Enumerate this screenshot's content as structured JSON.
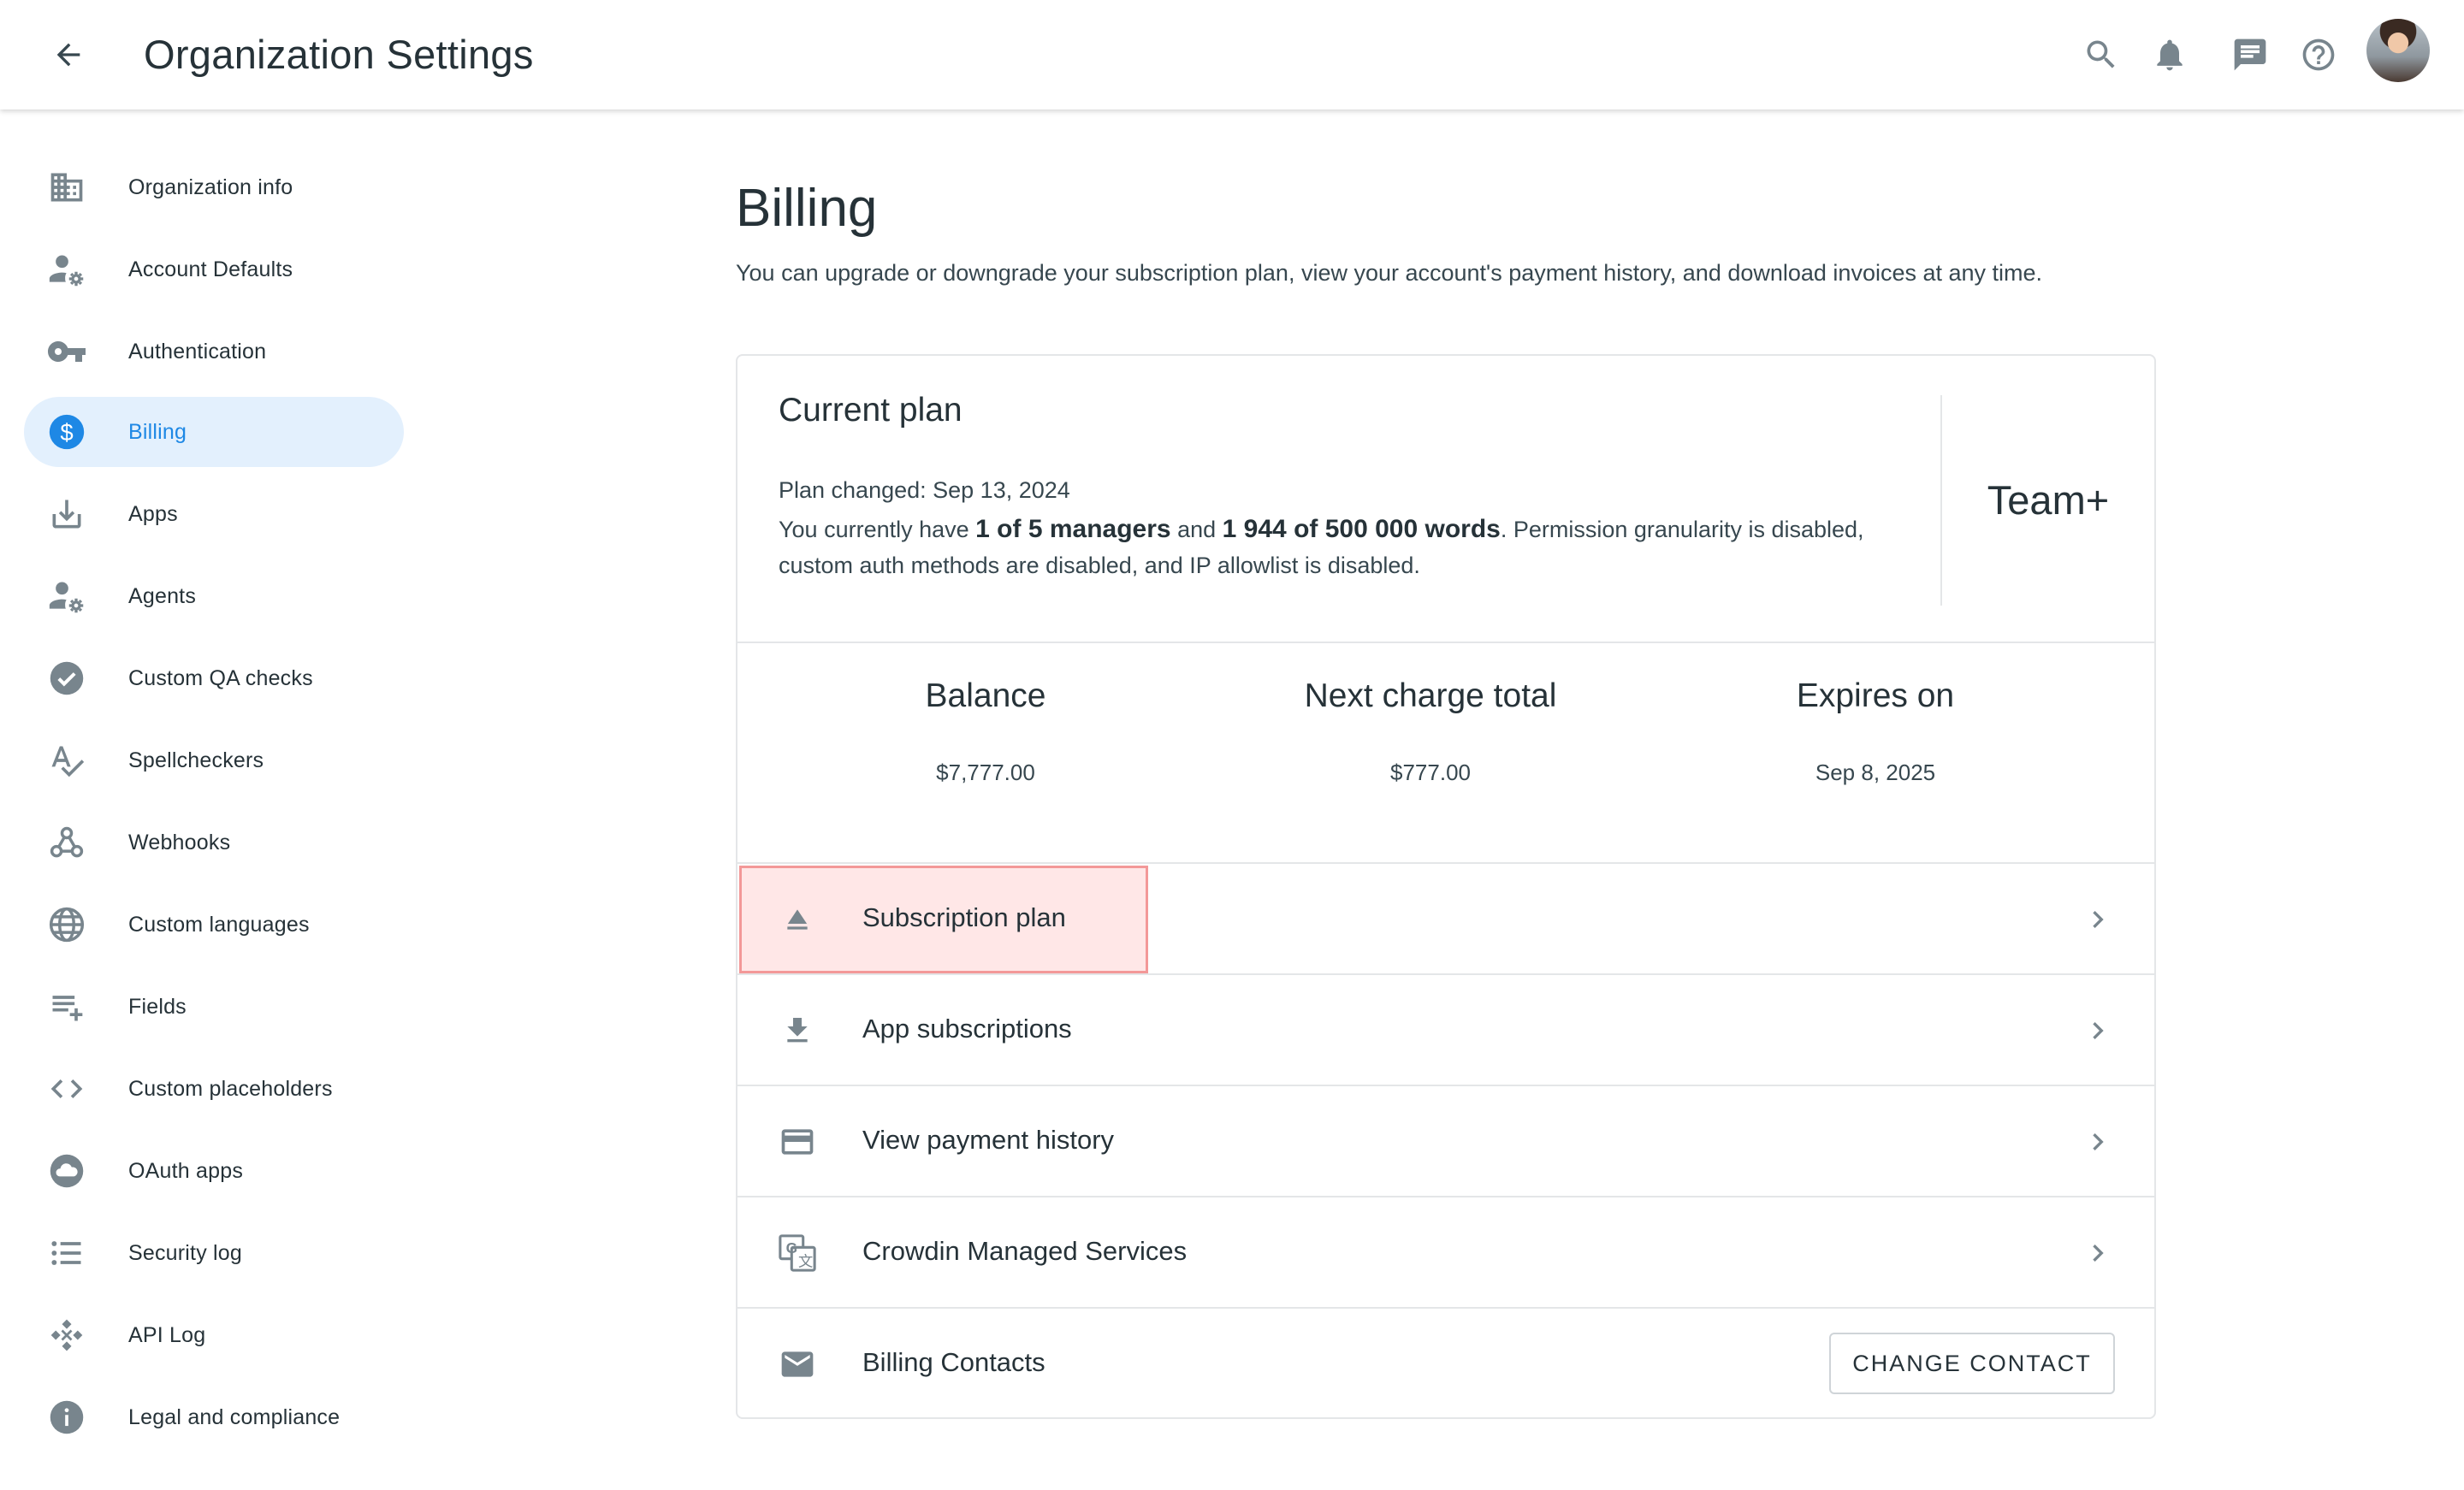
{
  "header": {
    "title": "Organization Settings",
    "icons": [
      "back-arrow-icon",
      "search-icon",
      "bell-icon",
      "chat-icon",
      "help-icon",
      "avatar"
    ]
  },
  "sidebar": {
    "items": [
      {
        "label": "Organization info",
        "icon": "building-icon",
        "active": false
      },
      {
        "label": "Account Defaults",
        "icon": "user-settings-icon",
        "active": false
      },
      {
        "label": "Authentication",
        "icon": "key-icon",
        "active": false
      },
      {
        "label": "Billing",
        "icon": "dollar-icon",
        "active": true
      },
      {
        "label": "Apps",
        "icon": "download-icon",
        "active": false
      },
      {
        "label": "Agents",
        "icon": "user-settings-icon",
        "active": false
      },
      {
        "label": "Custom QA checks",
        "icon": "check-circle-icon",
        "active": false
      },
      {
        "label": "Spellcheckers",
        "icon": "spellcheck-icon",
        "active": false
      },
      {
        "label": "Webhooks",
        "icon": "webhook-icon",
        "active": false
      },
      {
        "label": "Custom languages",
        "icon": "globe-icon",
        "active": false
      },
      {
        "label": "Fields",
        "icon": "playlist-add-icon",
        "active": false
      },
      {
        "label": "Custom placeholders",
        "icon": "code-icon",
        "active": false
      },
      {
        "label": "OAuth apps",
        "icon": "cloud-icon",
        "active": false
      },
      {
        "label": "Security log",
        "icon": "list-icon",
        "active": false
      },
      {
        "label": "API Log",
        "icon": "api-icon",
        "active": false
      },
      {
        "label": "Legal and compliance",
        "icon": "info-icon",
        "active": false
      }
    ]
  },
  "main": {
    "title": "Billing",
    "description": "You can upgrade or downgrade your subscription plan, view your account's payment history, and download invoices at any time.",
    "plan": {
      "heading": "Current plan",
      "changed": "Plan changed: Sep 13, 2024",
      "text_1": "You currently have ",
      "managers": "1 of 5 managers",
      "text_2": " and ",
      "words": "1 944 of 500 000 words",
      "text_3": ". Permission granularity is disabled, custom auth methods are disabled, and IP allowlist is disabled.",
      "name": "Team+"
    },
    "stats": [
      {
        "label": "Balance",
        "value": "$7,777.00"
      },
      {
        "label": "Next charge total",
        "value": "$777.00"
      },
      {
        "label": "Expires on",
        "value": "Sep 8, 2025"
      }
    ],
    "rows": [
      {
        "label": "Subscription plan",
        "icon": "eject-icon"
      },
      {
        "label": "App subscriptions",
        "icon": "download-icon"
      },
      {
        "label": "View payment history",
        "icon": "credit-card-icon"
      },
      {
        "label": "Crowdin Managed Services",
        "icon": "translate-icon"
      },
      {
        "label": "Billing Contacts",
        "icon": "mail-icon"
      }
    ],
    "change_contact_label": "CHANGE CONTACT"
  },
  "colors": {
    "accent": "#1e88e5",
    "active_bg": "#e3f0fd",
    "icon_gray": "#78858d",
    "highlight_border": "#f39898"
  }
}
